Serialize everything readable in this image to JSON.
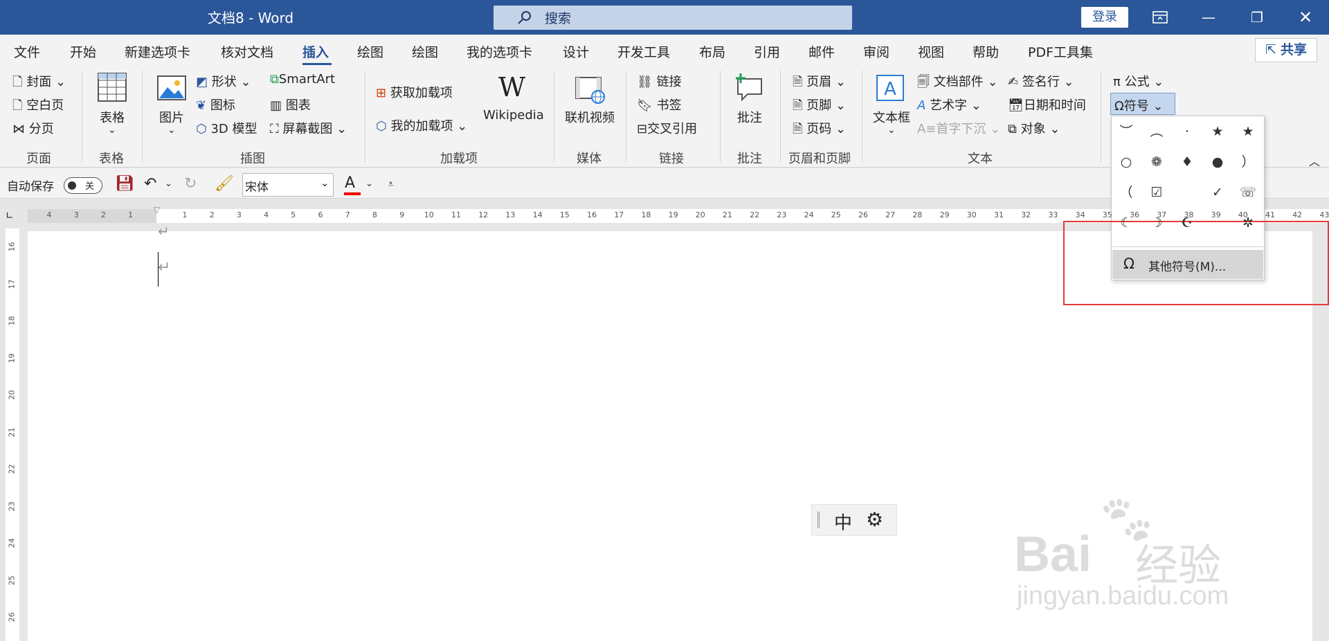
{
  "window": {
    "title": "文档8  -  Word",
    "search_placeholder": "搜索",
    "login": "登录",
    "share": "共享"
  },
  "tabs": [
    "文件",
    "开始",
    "新建选项卡",
    "核对文档",
    "插入",
    "绘图",
    "绘图",
    "我的选项卡",
    "设计",
    "开发工具",
    "布局",
    "引用",
    "邮件",
    "审阅",
    "视图",
    "帮助",
    "PDF工具集"
  ],
  "active_tab": "插入",
  "ribbon": {
    "page": {
      "cover": "封面",
      "blank": "空白页",
      "break": "分页",
      "label": "页面"
    },
    "table": {
      "table": "表格",
      "label": "表格"
    },
    "illustrations": {
      "pictures": "图片",
      "shapes": "形状",
      "icons": "图标",
      "model3d": "3D 模型",
      "smartart": "SmartArt",
      "chart": "图表",
      "screenshot": "屏幕截图",
      "label": "插图"
    },
    "addins": {
      "get": "获取加载项",
      "my": "我的加载项",
      "wikipedia": "Wikipedia",
      "label": "加载项"
    },
    "media": {
      "video": "联机视频",
      "label": "媒体"
    },
    "links": {
      "link": "链接",
      "bookmark": "书签",
      "crossref": "交叉引用",
      "label": "链接"
    },
    "comments": {
      "comment": "批注",
      "label": "批注"
    },
    "header_footer": {
      "header": "页眉",
      "footer": "页脚",
      "page_number": "页码",
      "label": "页眉和页脚"
    },
    "text": {
      "textbox": "文本框",
      "quickparts": "文档部件",
      "wordart": "艺术字",
      "dropcap": "首字下沉",
      "signature": "签名行",
      "datetime": "日期和时间",
      "object": "对象",
      "label": "文本"
    },
    "symbols": {
      "equation": "公式",
      "symbol": "符号"
    }
  },
  "qat": {
    "autosave": "自动保存",
    "autosave_state": "关",
    "font": "宋体"
  },
  "ruler": {
    "h_ticks": [
      "4",
      "3",
      "2",
      "1",
      "",
      "1",
      "2",
      "3",
      "4",
      "5",
      "6",
      "7",
      "8",
      "9",
      "10",
      "11",
      "12",
      "13",
      "14",
      "15",
      "16",
      "17",
      "18",
      "19",
      "20",
      "21",
      "22",
      "23",
      "24",
      "25",
      "26",
      "27",
      "28",
      "29",
      "30",
      "31",
      "32",
      "33",
      "34",
      "35",
      "36",
      "37",
      "38",
      "39",
      "40",
      "41",
      "42",
      "43"
    ],
    "v_ticks": [
      "16",
      "17",
      "18",
      "19",
      "20",
      "21",
      "22",
      "23",
      "24",
      "25",
      "26"
    ]
  },
  "symbol_dropdown": {
    "symbols": [
      "︶",
      "︵",
      "·",
      "★",
      "★",
      "○",
      "❁",
      "♦",
      "●",
      "）",
      "（",
      "☑",
      "",
      "✓",
      "☏",
      "☾",
      "☽",
      "☪",
      "",
      "✲"
    ],
    "more": "其他符号(M)..."
  },
  "ime": {
    "mode": "中"
  },
  "watermark": {
    "brand": "Bai",
    "brand2": "经验",
    "url": "jingyan.baidu.com"
  },
  "colors": {
    "accent": "#2b579a",
    "highlight": "#e53935"
  }
}
